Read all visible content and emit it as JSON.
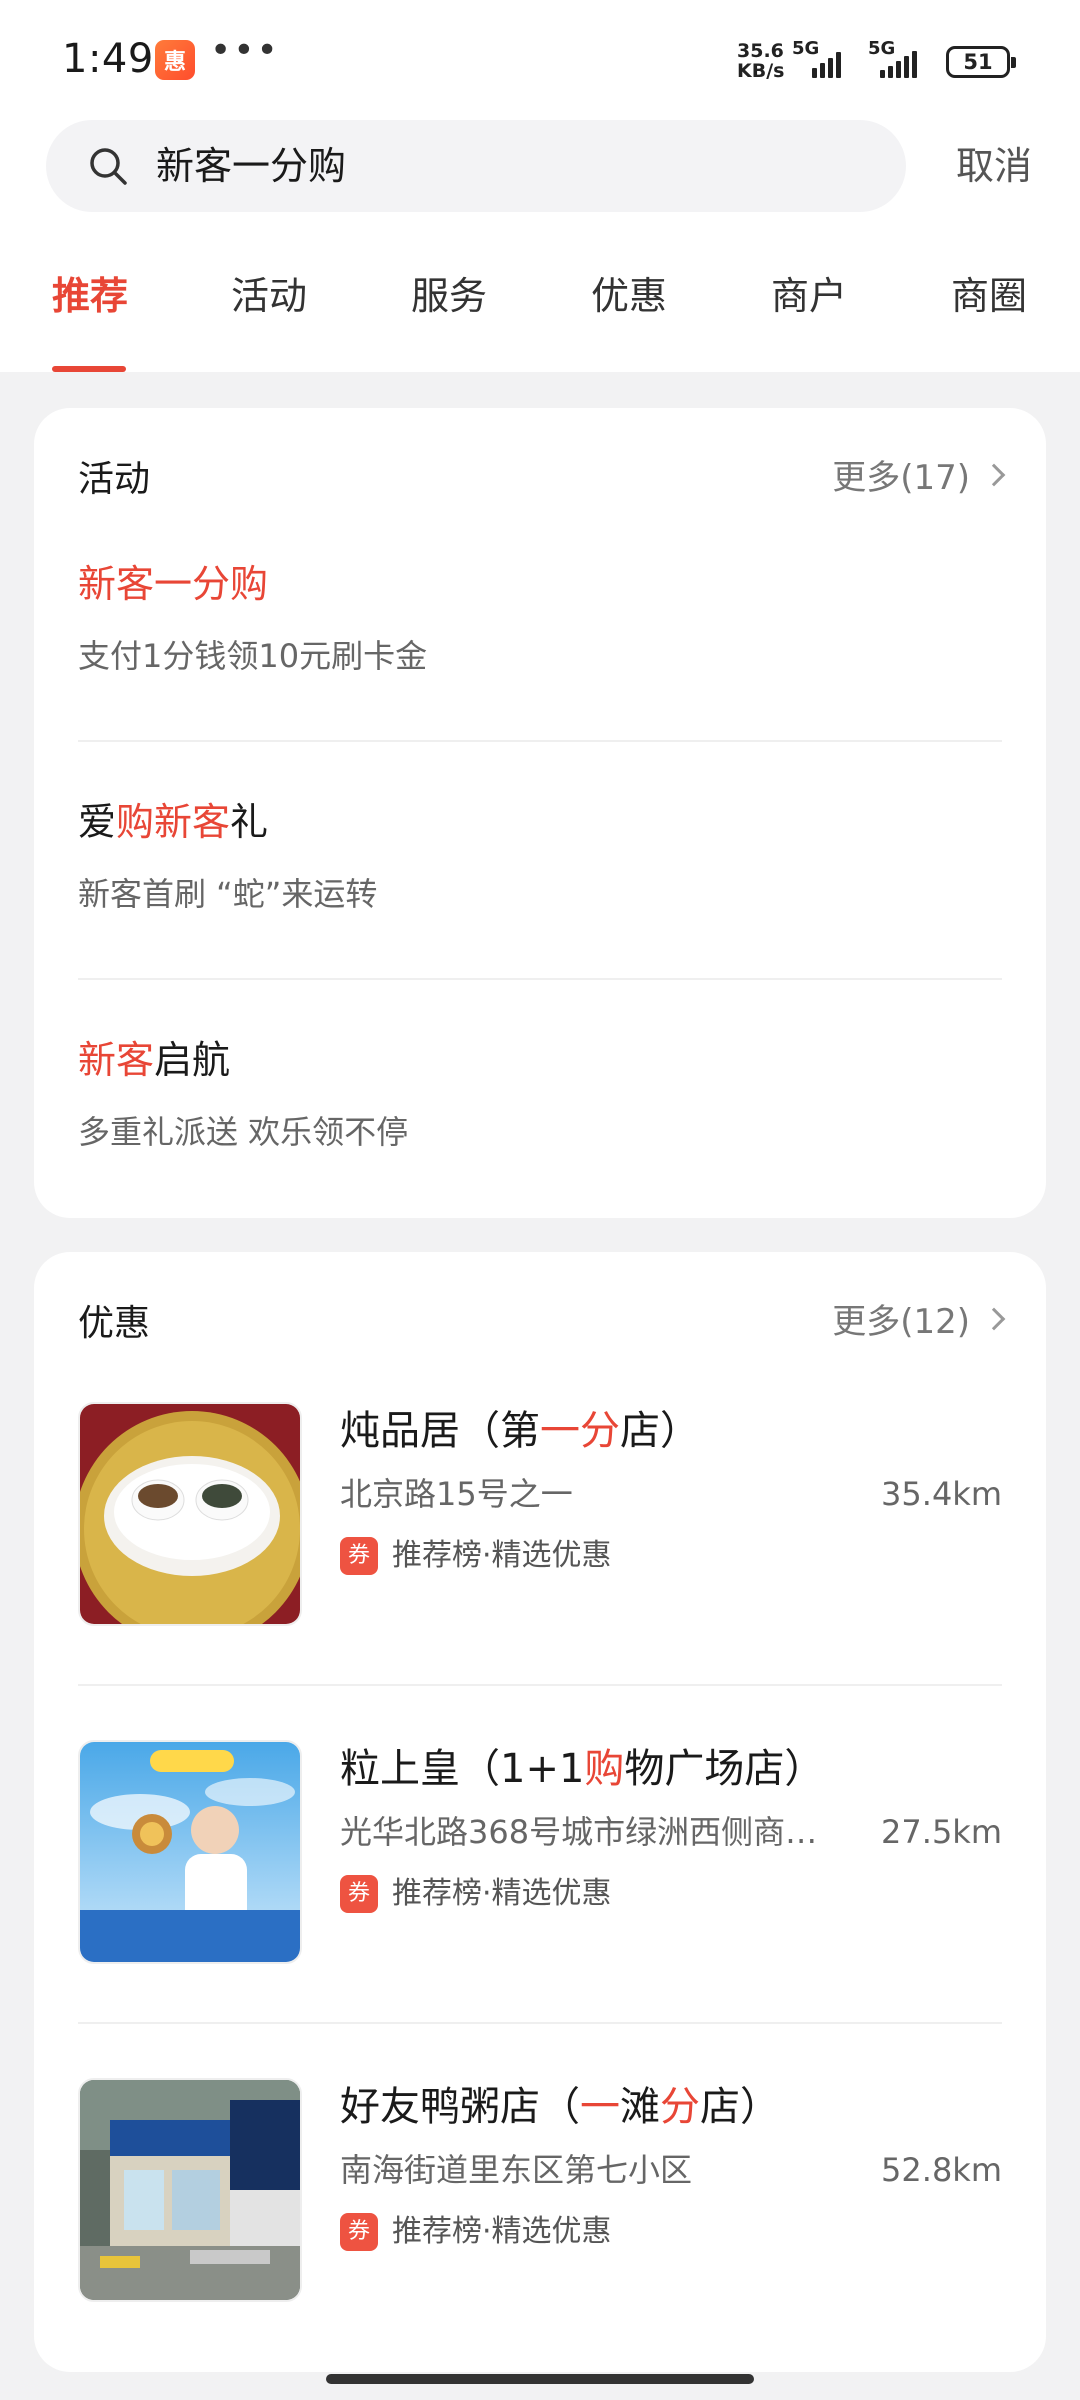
{
  "status_bar": {
    "time": "1:49",
    "app_badge": "惠",
    "more": "•••",
    "net_speed_value": "35.6",
    "net_speed_unit": "KB/s",
    "sig1": "5G",
    "sig2": "5G",
    "battery": "51"
  },
  "search": {
    "query": "新客一分购",
    "cancel_label": "取消"
  },
  "tabs": [
    {
      "label": "推荐",
      "active": true
    },
    {
      "label": "活动"
    },
    {
      "label": "服务"
    },
    {
      "label": "优惠"
    },
    {
      "label": "商户"
    },
    {
      "label": "商圈"
    }
  ],
  "activities": {
    "title": "活动",
    "more": "更多(17)",
    "items": [
      {
        "title_parts": [
          {
            "t": "新客一分购",
            "hl": true
          }
        ],
        "sub": "支付1分钱领10元刷卡金"
      },
      {
        "title_parts": [
          {
            "t": "爱",
            "hl": false
          },
          {
            "t": "购新客",
            "hl": true
          },
          {
            "t": "礼",
            "hl": false
          }
        ],
        "sub": "新客首刷 “蛇”来运转"
      },
      {
        "title_parts": [
          {
            "t": "新客",
            "hl": true
          },
          {
            "t": "启航",
            "hl": false
          }
        ],
        "sub": "多重礼派送 欢乐领不停"
      }
    ]
  },
  "deals": {
    "title": "优惠",
    "more": "更多(12)",
    "coupon_icon": "券",
    "items": [
      {
        "name_parts": [
          {
            "t": "炖品居（第",
            "hl": false
          },
          {
            "t": "一分",
            "hl": true
          },
          {
            "t": "店）",
            "hl": false
          }
        ],
        "address": "北京路15号之一",
        "distance": "35.4km",
        "tag": "推荐榜·精选优惠",
        "thumb_icon": "soup-bowls-photo"
      },
      {
        "name_parts": [
          {
            "t": "粒上皇（1+1",
            "hl": false
          },
          {
            "t": "购",
            "hl": true
          },
          {
            "t": "物广场店）",
            "hl": false
          }
        ],
        "address": "光华北路368号城市绿洲西侧商…",
        "distance": "27.5km",
        "tag": "推荐榜·精选优惠",
        "thumb_icon": "chestnut-ad-photo"
      },
      {
        "name_parts": [
          {
            "t": "好友鸭粥店（",
            "hl": false
          },
          {
            "t": "一",
            "hl": true
          },
          {
            "t": "滩",
            "hl": false
          },
          {
            "t": "分",
            "hl": true
          },
          {
            "t": "店）",
            "hl": false
          }
        ],
        "address": "南海街道里东区第七小区",
        "distance": "52.8km",
        "tag": "推荐榜·精选优惠",
        "thumb_icon": "storefront-photo"
      }
    ]
  },
  "colors": {
    "accent": "#e84636",
    "background": "#f2f2f3",
    "card": "#ffffff"
  }
}
